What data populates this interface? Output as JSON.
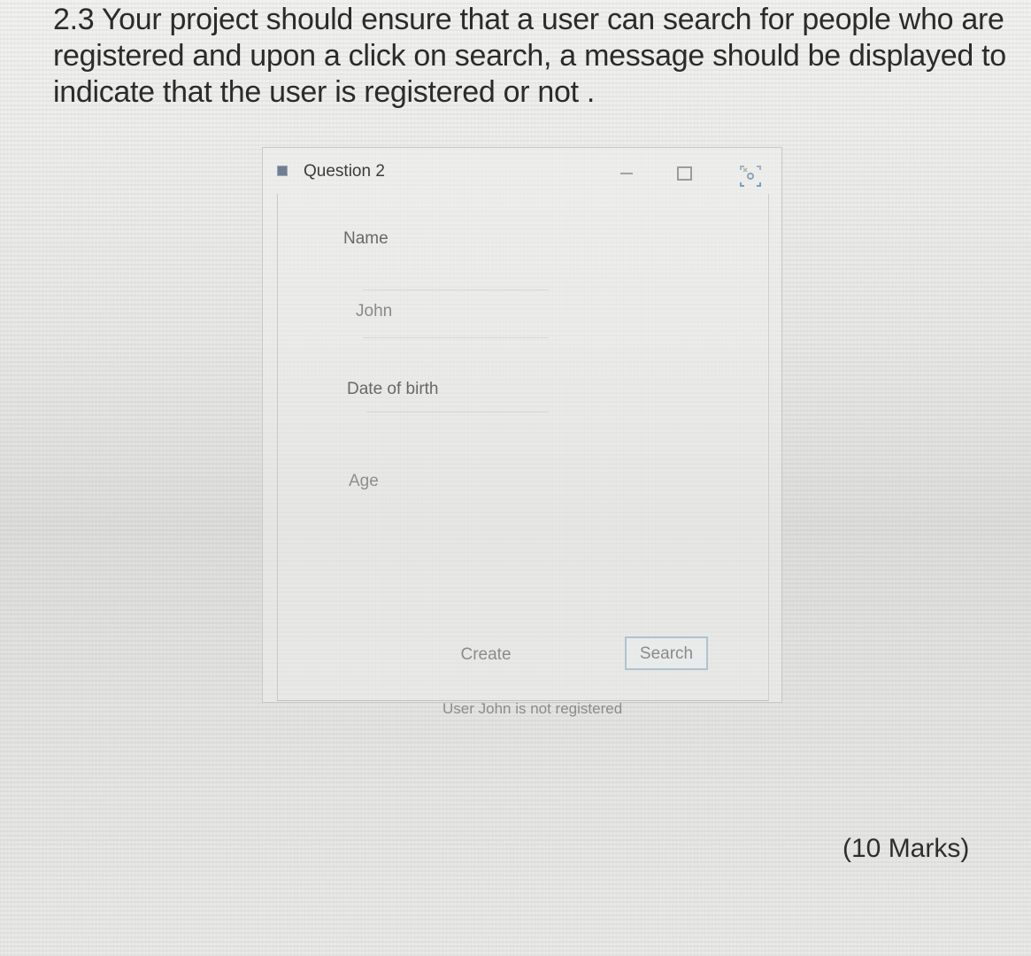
{
  "question": {
    "text": "2.3 Your project should ensure that a user can search for people who are registered and upon a click on search, a message should be displayed to indicate that the user is registered or not .",
    "marks": "(10 Marks)"
  },
  "window": {
    "title": "Question 2",
    "icons": {
      "app": "app-icon",
      "minimize": "minimize-icon",
      "maximize": "maximize-icon",
      "close": "close-icon"
    }
  },
  "form": {
    "name_label": "Name",
    "name_value": "John",
    "dob_label": "Date of birth",
    "age_label": "Age",
    "create_label": "Create",
    "search_label": "Search",
    "status_message": "User John is not registered"
  }
}
